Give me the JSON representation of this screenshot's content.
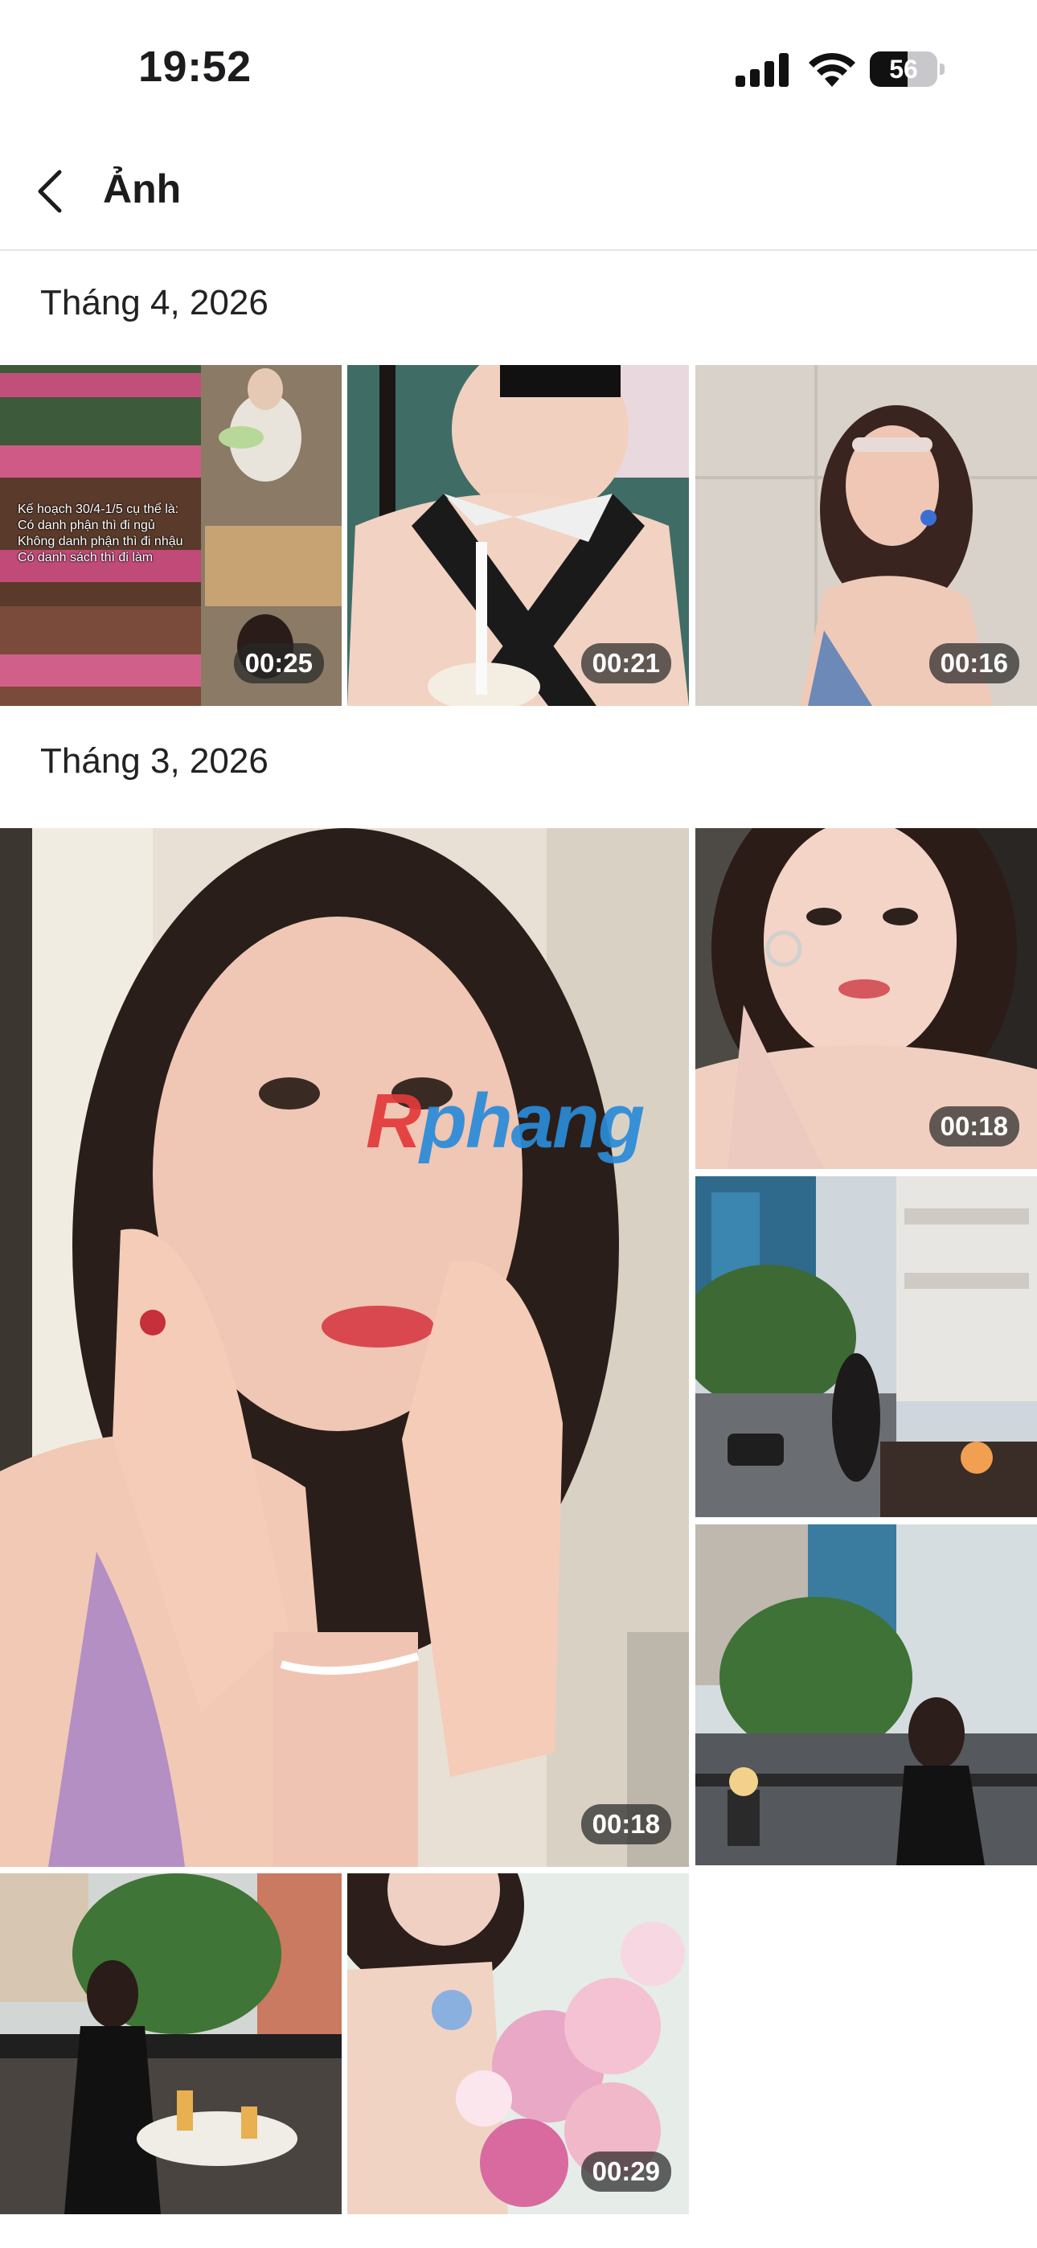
{
  "status_bar": {
    "time": "19:52",
    "battery_level": "56",
    "icons": [
      "signal-icon",
      "wifi-icon",
      "battery-icon"
    ]
  },
  "nav": {
    "title": "Ảnh",
    "back_icon": "chevron-left-icon"
  },
  "sections": [
    {
      "header": "Tháng 4, 2026",
      "items": [
        {
          "duration": "00:25",
          "caption": "Kế hoạch 30/4-1/5 cụ thể là:\nCó danh phận thì đi ngủ\nKhông danh phận thì đi nhậu\nCó danh sách thì đi làm"
        },
        {
          "duration": "00:21"
        },
        {
          "duration": "00:16"
        }
      ]
    },
    {
      "header": "Tháng 3, 2026",
      "items": [
        {
          "duration": "00:18"
        },
        {
          "duration": "00:18"
        },
        {
          "duration": ""
        },
        {
          "duration": ""
        },
        {
          "duration": ""
        },
        {
          "duration": "00:29"
        }
      ]
    }
  ],
  "watermark": {
    "first": "R",
    "rest": "phang"
  },
  "colors": {
    "accent_text": "#1c1c1e",
    "duration_bg": "#282828",
    "divider": "#e4e4e4"
  }
}
